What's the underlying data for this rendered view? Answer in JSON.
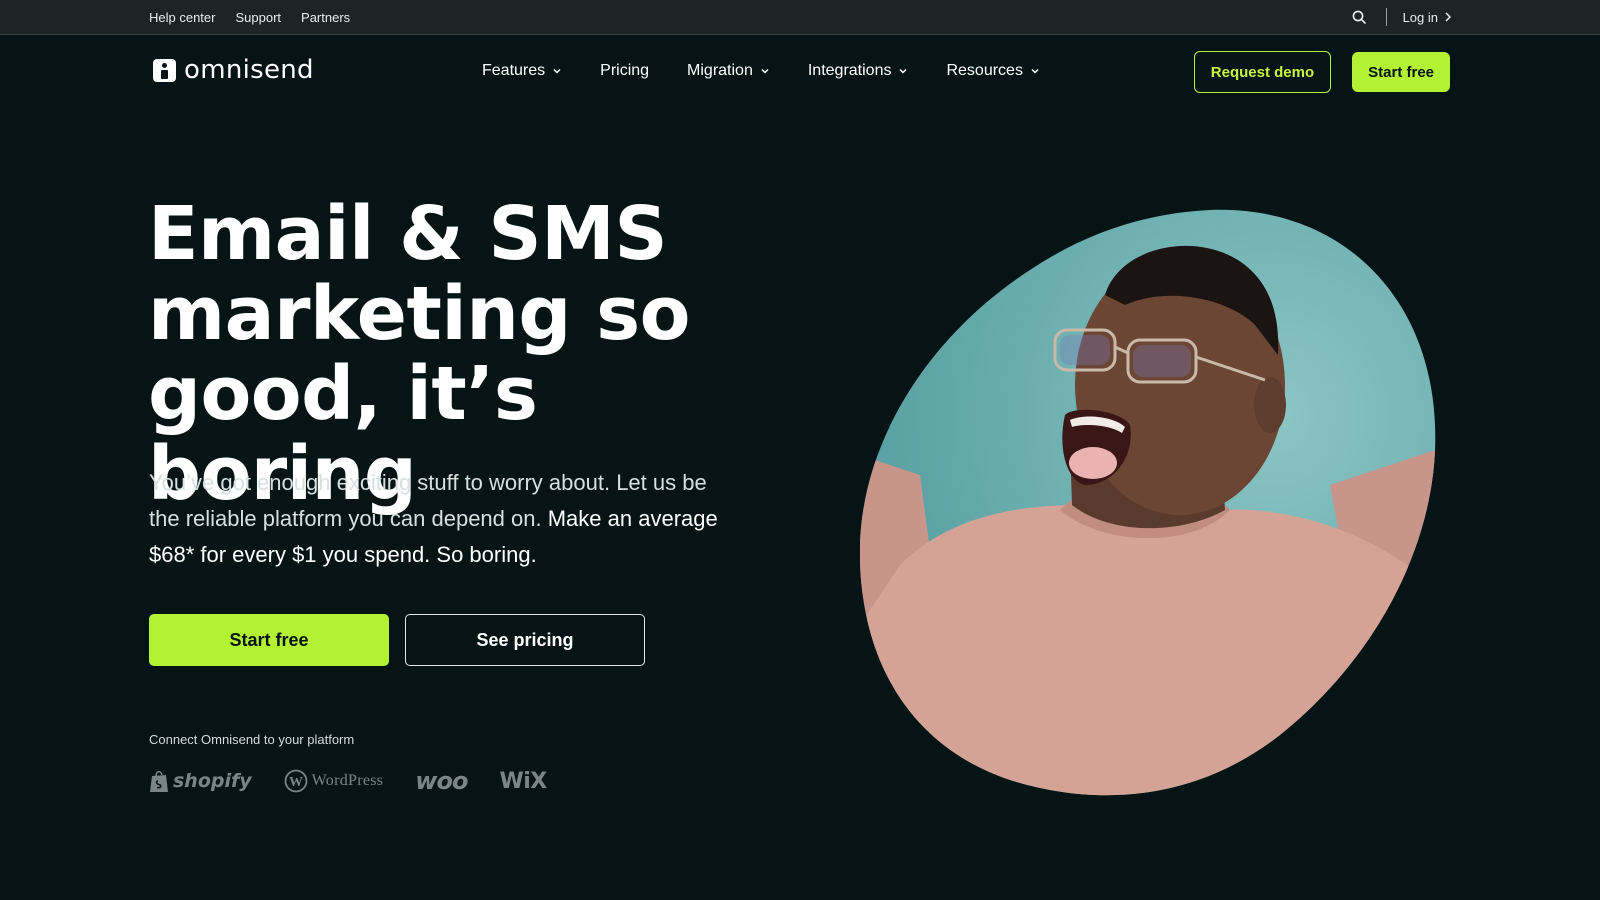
{
  "topbar": {
    "links": [
      "Help center",
      "Support",
      "Partners"
    ],
    "login_label": "Log in"
  },
  "nav": {
    "logo_text": "omnisend",
    "menu": [
      {
        "label": "Features",
        "has_dropdown": true
      },
      {
        "label": "Pricing",
        "has_dropdown": false
      },
      {
        "label": "Migration",
        "has_dropdown": true
      },
      {
        "label": "Integrations",
        "has_dropdown": true
      },
      {
        "label": "Resources",
        "has_dropdown": true
      }
    ],
    "request_demo_label": "Request demo",
    "start_free_label": "Start free"
  },
  "hero": {
    "title_line1": "Email & SMS",
    "title_line2": "marketing so",
    "title_line3": "good, it’s boring",
    "subtitle_plain": "You’ve got enough exciting stuff to worry about. Let us be the reliable platform you can depend on.",
    "subtitle_strong": "Make an average $68* for every $1 you spend. So boring.",
    "cta_primary": "Start free",
    "cta_secondary": "See pricing",
    "connect_label": "Connect Omnisend to your platform",
    "platforms": [
      "shopify",
      "WordPress",
      "woo",
      "WiX"
    ]
  },
  "colors": {
    "background": "#071415",
    "topbar": "#1d2424",
    "accent_green": "#b3f233",
    "hero_image_bg": "#6fb1b1",
    "sweater": "#d4a396"
  },
  "icons": {
    "search": "search-icon",
    "login_chevron": "chevron-right-icon",
    "dropdown": "chevron-down-icon"
  }
}
